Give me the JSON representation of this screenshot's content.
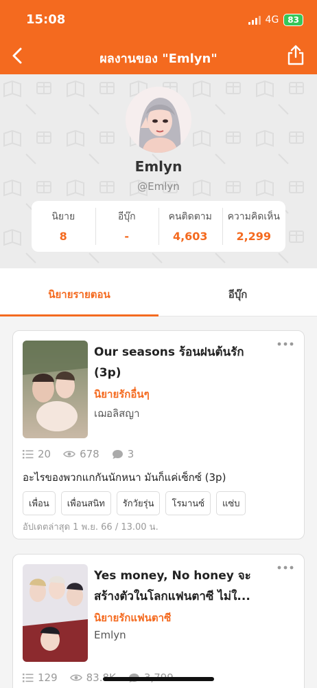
{
  "status": {
    "time": "15:08",
    "network": "4G",
    "battery": "83"
  },
  "header": {
    "title": "ผลงานของ \"Emlyn\"",
    "back_icon": "chevron-left-icon",
    "share_icon": "share-icon"
  },
  "profile": {
    "name": "Emlyn",
    "handle": "@Emlyn",
    "stats": [
      {
        "label": "นิยาย",
        "value": "8"
      },
      {
        "label": "อีบุ๊ก",
        "value": "-"
      },
      {
        "label": "คนติดตาม",
        "value": "4,603"
      },
      {
        "label": "ความคิดเห็น",
        "value": "2,299"
      }
    ]
  },
  "tabs": [
    {
      "label": "นิยายรายตอน",
      "active": true
    },
    {
      "label": "อีบุ๊ก",
      "active": false
    }
  ],
  "novels": [
    {
      "title": "Our seasons ร้อนฝนต้นรัก (3p)",
      "category": "นิยายรักอื่นๆ",
      "author": "เฌอลิสญา",
      "chapters": "20",
      "views": "678",
      "comments": "3",
      "description": "อะไรของพวกแกกันนักหนา มันก็แค่เซ็กซ์ (3p)",
      "tags": [
        "เพื่อน",
        "เพื่อนสนิท",
        "รักวัยรุ่น",
        "โรมานซ์",
        "แซ่บ"
      ],
      "updated": "อัปเดตล่าสุด 1 พ.ย. 66 / 13.00 น."
    },
    {
      "title": "Yes money, No honey จะสร้างตัวในโลกแฟนตาซี ไม่ใ...",
      "category": "นิยายรักแฟนตาซี",
      "author": "Emlyn",
      "chapters": "129",
      "views": "83.8K",
      "comments": "3,799"
    }
  ],
  "colors": {
    "accent": "#F46A1F",
    "background": "#ececec"
  }
}
